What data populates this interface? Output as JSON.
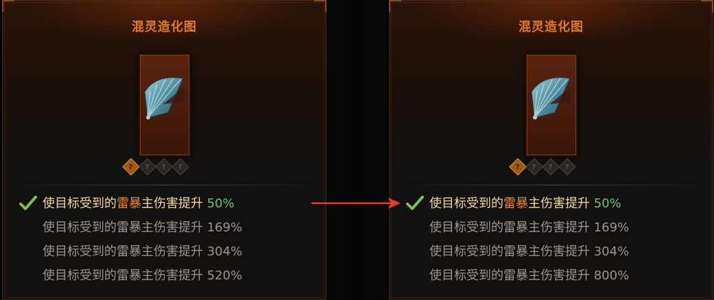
{
  "panels": [
    {
      "title": "混灵造化图",
      "item_icon": "fan-icon",
      "sockets": [
        {
          "glyph": "?",
          "active": true
        },
        {
          "glyph": "?",
          "active": false
        },
        {
          "glyph": "?",
          "active": false
        },
        {
          "glyph": "?",
          "active": false
        }
      ],
      "effects": [
        {
          "prefix": "使目标受到的",
          "keyword": "雷暴",
          "suffix": "主伤害提升 ",
          "value": "50%",
          "active": true
        },
        {
          "text": "使目标受到的雷暴主伤害提升 169%",
          "active": false
        },
        {
          "text": "使目标受到的雷暴主伤害提升 304%",
          "active": false
        },
        {
          "text": "使目标受到的雷暴主伤害提升 520%",
          "active": false
        }
      ]
    },
    {
      "title": "混灵造化图",
      "item_icon": "fan-icon",
      "sockets": [
        {
          "glyph": "?",
          "active": true
        },
        {
          "glyph": "?",
          "active": false
        },
        {
          "glyph": "?",
          "active": false
        },
        {
          "glyph": "?",
          "active": false
        }
      ],
      "effects": [
        {
          "prefix": "使目标受到的",
          "keyword": "雷暴",
          "suffix": "主伤害提升 ",
          "value": "50%",
          "active": true
        },
        {
          "text": "使目标受到的雷暴主伤害提升 169%",
          "active": false
        },
        {
          "text": "使目标受到的雷暴主伤害提升 304%",
          "active": false
        },
        {
          "text": "使目标受到的雷暴主伤害提升 800%",
          "active": false
        }
      ]
    }
  ],
  "colors": {
    "title": "#e07a2a",
    "keyword": "#e08838",
    "active_value": "#6cc47a",
    "inactive_text": "#9a9590",
    "arrow": "#e8382c"
  }
}
